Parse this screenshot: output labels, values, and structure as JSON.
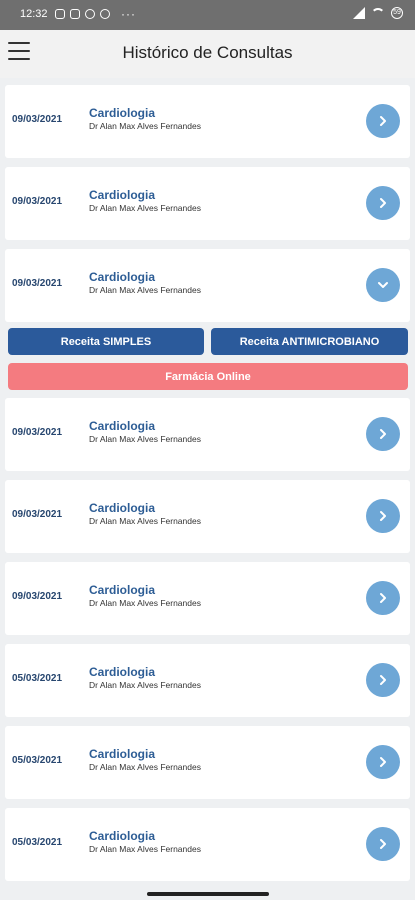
{
  "status_bar": {
    "time": "12:32",
    "left_icons": [
      "shield-icon",
      "message-icon",
      "whatsapp-icon",
      "app-icon"
    ],
    "overflow": "···",
    "right_icons": [
      "signal-icon",
      "wifi-icon",
      "battery-icon"
    ],
    "battery_text": "59"
  },
  "header": {
    "title": "Histórico de Consultas"
  },
  "consultations": [
    {
      "date": "09/03/2021",
      "specialty": "Cardiologia",
      "doctor": "Dr Alan Max Alves Fernandes",
      "expanded": false
    },
    {
      "date": "09/03/2021",
      "specialty": "Cardiologia",
      "doctor": "Dr Alan Max Alves Fernandes",
      "expanded": false
    },
    {
      "date": "09/03/2021",
      "specialty": "Cardiologia",
      "doctor": "Dr Alan Max Alves Fernandes",
      "expanded": true
    },
    {
      "date": "09/03/2021",
      "specialty": "Cardiologia",
      "doctor": "Dr Alan Max Alves Fernandes",
      "expanded": false
    },
    {
      "date": "09/03/2021",
      "specialty": "Cardiologia",
      "doctor": "Dr Alan Max Alves Fernandes",
      "expanded": false
    },
    {
      "date": "09/03/2021",
      "specialty": "Cardiologia",
      "doctor": "Dr Alan Max Alves Fernandes",
      "expanded": false
    },
    {
      "date": "05/03/2021",
      "specialty": "Cardiologia",
      "doctor": "Dr Alan Max Alves Fernandes",
      "expanded": false
    },
    {
      "date": "05/03/2021",
      "specialty": "Cardiologia",
      "doctor": "Dr Alan Max Alves Fernandes",
      "expanded": false
    },
    {
      "date": "05/03/2021",
      "specialty": "Cardiologia",
      "doctor": "Dr Alan Max Alves Fernandes",
      "expanded": false
    }
  ],
  "expanded_actions": {
    "receita_simples": "Receita SIMPLES",
    "receita_antimicrobiano": "Receita ANTIMICROBIANO",
    "farmacia_online": "Farmácia Online"
  },
  "colors": {
    "primary": "#2b5a9b",
    "chevron_bg": "#6ea7d6",
    "pharmacy": "#f47b80",
    "date_text": "#27466f"
  }
}
